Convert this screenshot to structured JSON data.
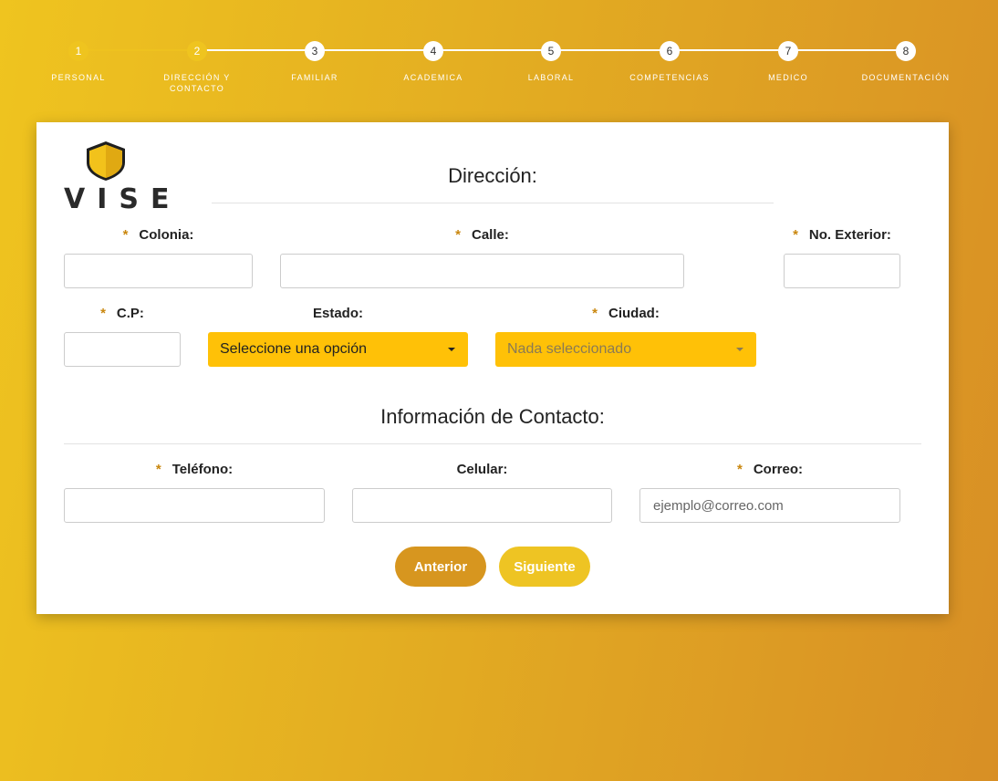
{
  "steps": [
    {
      "number": "1",
      "label": "PERSONAL",
      "state": "done"
    },
    {
      "number": "2",
      "label": "DIRECCIÓN Y CONTACTO",
      "state": "current"
    },
    {
      "number": "3",
      "label": "FAMILIAR",
      "state": "pending"
    },
    {
      "number": "4",
      "label": "ACADEMICA",
      "state": "pending"
    },
    {
      "number": "5",
      "label": "LABORAL",
      "state": "pending"
    },
    {
      "number": "6",
      "label": "COMPETENCIAS",
      "state": "pending"
    },
    {
      "number": "7",
      "label": "MEDICO",
      "state": "pending"
    },
    {
      "number": "8",
      "label": "DOCUMENTACIÓN",
      "state": "pending"
    }
  ],
  "logo": {
    "text": "VISE",
    "icon": "shield-icon"
  },
  "direccion": {
    "title": "Dirección:",
    "colonia_label": "Colonia:",
    "calle_label": "Calle:",
    "no_exterior_label": "No. Exterior:",
    "cp_label": "C.P:",
    "estado_label": "Estado:",
    "estado_value": "Seleccione una opción",
    "ciudad_label": "Ciudad:",
    "ciudad_value": "Nada seleccionado",
    "required_mark": "*"
  },
  "contacto": {
    "title": "Información de Contacto:",
    "telefono_label": "Teléfono:",
    "celular_label": "Celular:",
    "correo_label": "Correo:",
    "correo_placeholder": "ejemplo@correo.com"
  },
  "buttons": {
    "anterior": "Anterior",
    "siguiente": "Siguiente"
  },
  "colors": {
    "accent": "#ffc107",
    "anterior_button": "#d7961f",
    "siguiente_button": "#eec423",
    "required": "#c9870e"
  }
}
